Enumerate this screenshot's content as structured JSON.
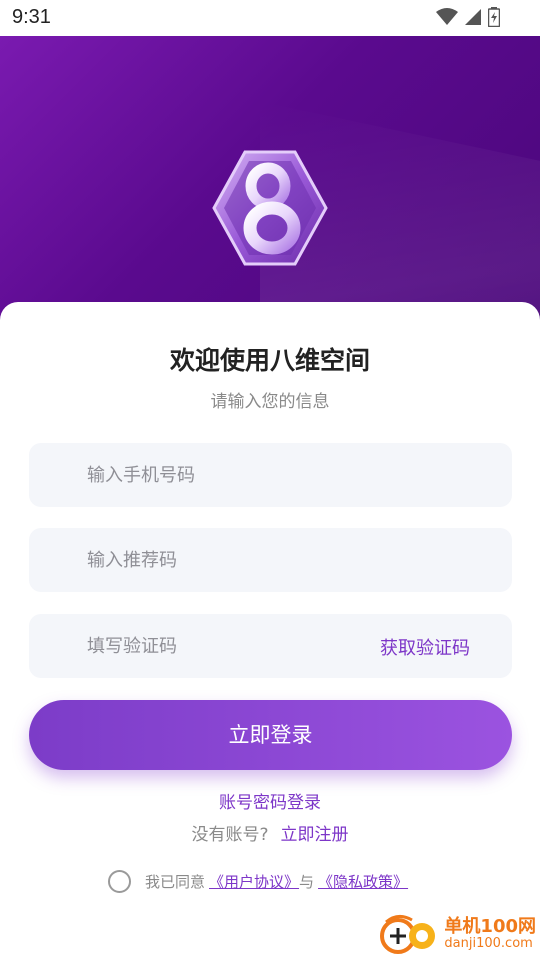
{
  "status_bar": {
    "time": "9:31"
  },
  "header": {
    "title": "欢迎使用八维空间",
    "subtitle": "请输入您的信息"
  },
  "form": {
    "phone_placeholder": "输入手机号码",
    "referral_placeholder": "输入推荐码",
    "code_placeholder": "填写验证码",
    "get_code_label": "获取验证码",
    "login_label": "立即登录"
  },
  "links": {
    "password_login": "账号密码登录",
    "no_account": "没有账号?",
    "register": "立即注册"
  },
  "agreement": {
    "prefix": "我已同意",
    "user_agreement": "《用户协议》",
    "conjunction": "与",
    "privacy_policy": "《隐私政策》",
    "checked": false
  },
  "watermark": {
    "name": "单机100网",
    "domain": "danji100.com"
  },
  "colors": {
    "accent": "#7d36c8",
    "hero": "#5a0a8e"
  }
}
